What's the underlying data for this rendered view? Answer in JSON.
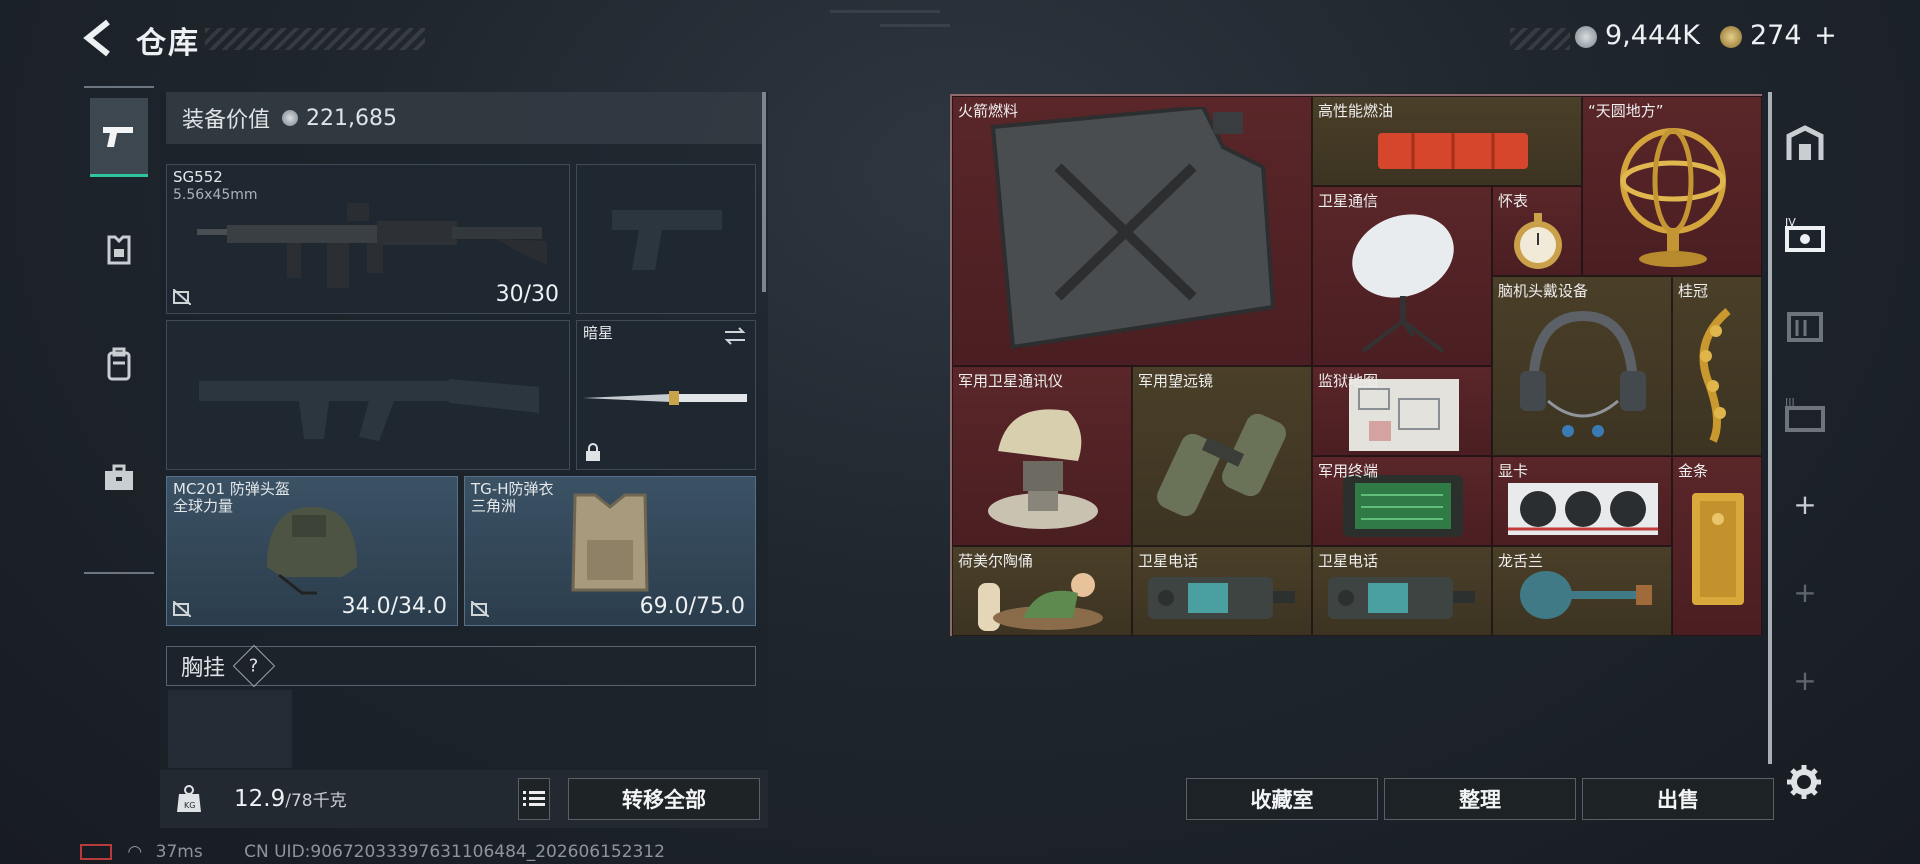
{
  "header": {
    "title": "仓库",
    "currency_primary": "9,444K",
    "currency_secondary": "274",
    "currency_secondary_add": "+"
  },
  "left_nav": {
    "items": [
      {
        "name": "weapons",
        "icon": "pistol-icon",
        "active": true
      },
      {
        "name": "armor",
        "icon": "armor-icon",
        "active": false
      },
      {
        "name": "backpack",
        "icon": "backpack-icon",
        "active": false
      },
      {
        "name": "case",
        "icon": "briefcase-icon",
        "active": false
      }
    ]
  },
  "loadout": {
    "equip_value_label": "装备价值",
    "equip_value": "221,685",
    "primary": {
      "name": "SG552",
      "ammo": "5.56x45mm",
      "durability": "30/30"
    },
    "melee": {
      "name": "暗星"
    },
    "helmet": {
      "name": "MC201 防弹头盔",
      "faction": "全球力量",
      "durability": "34.0/34.0"
    },
    "armor": {
      "name": "TG-H防弹衣",
      "faction": "三角洲",
      "durability": "69.0/75.0"
    },
    "chest_label": "胸挂",
    "chest_help": "?",
    "weight_value": "12.9",
    "weight_max": "/78千克",
    "transfer_all": "转移全部"
  },
  "warehouse": {
    "items": [
      {
        "label": "火箭燃料",
        "icon": "jerrycan-icon",
        "rarity": "red"
      },
      {
        "label": "高性能燃油",
        "icon": "fuel-case-icon",
        "rarity": "gold"
      },
      {
        "label": "“天圆地方”",
        "icon": "armillary-sphere-icon",
        "rarity": "red"
      },
      {
        "label": "卫星通信",
        "icon": "satellite-dish-icon",
        "rarity": "red"
      },
      {
        "label": "怀表",
        "icon": "pocket-watch-icon",
        "rarity": "red"
      },
      {
        "label": "脑机头戴设备",
        "icon": "headset-icon",
        "rarity": "gold"
      },
      {
        "label": "桂冠",
        "icon": "laurel-crown-icon",
        "rarity": "gold"
      },
      {
        "label": "军用卫星通讯仪",
        "icon": "satellite-device-icon",
        "rarity": "red"
      },
      {
        "label": "军用望远镜",
        "icon": "binoculars-icon",
        "rarity": "gold"
      },
      {
        "label": "监狱地图",
        "icon": "map-icon",
        "rarity": "red"
      },
      {
        "label": "军用终端",
        "icon": "terminal-icon",
        "rarity": "red"
      },
      {
        "label": "显卡",
        "icon": "graphics-card-icon",
        "rarity": "red"
      },
      {
        "label": "金条",
        "icon": "gold-bar-icon",
        "rarity": "red"
      },
      {
        "label": "荷美尔陶俑",
        "icon": "figurine-icon",
        "rarity": "gold"
      },
      {
        "label": "卫星电话",
        "icon": "sat-phone-icon",
        "rarity": "gold"
      },
      {
        "label": "卫星电话",
        "icon": "sat-phone-icon",
        "rarity": "gold"
      },
      {
        "label": "龙舌兰",
        "icon": "bottle-icon",
        "rarity": "gold"
      }
    ],
    "buttons": {
      "collection": "收藏室",
      "organize": "整理",
      "sell": "出售"
    }
  },
  "right_nav": {
    "plus": "+"
  },
  "status": {
    "ping": "37ms",
    "uid": "CN UID:9067203339763110648​4_202606152312"
  },
  "colors": {
    "accent": "#2ec4a0",
    "red_rarity": "#5a2629",
    "gold_rarity": "#4a3f28"
  }
}
